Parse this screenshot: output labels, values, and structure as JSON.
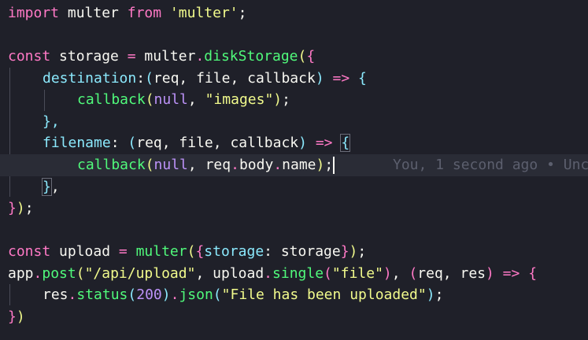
{
  "editor": {
    "blame_text": "You, 1 second ago • Unc",
    "colors": {
      "background": "#1f2029",
      "current_line": "#2a2c36",
      "keyword": "#ff79c6",
      "string": "#f1fa8c",
      "function": "#50fa7b",
      "property": "#8be9fd",
      "number": "#bd93f9",
      "text": "#f8f8f2"
    },
    "code": {
      "l1": {
        "import": "import",
        "multer": " multer ",
        "from": "from",
        "module": " 'multer'",
        "semi": ";"
      },
      "l3": {
        "const": "const",
        "name": " storage ",
        "eq": "= ",
        "obj": "multer",
        "dot": ".",
        "method": "diskStorage",
        "open": "(",
        "brace": "{"
      },
      "l4": {
        "key": "destination",
        "colon": ":",
        "open": "(",
        "params": "req, file, callback",
        "close": ")",
        "arrow": " => ",
        "brace": "{"
      },
      "l5": {
        "fn": "callback",
        "open": "(",
        "arg1": "null",
        "comma": ", ",
        "arg2": "\"images\"",
        "close": ")",
        "semi": ";"
      },
      "l6": {
        "close": "},"
      },
      "l7": {
        "key": "filename",
        "colon": ": ",
        "open": "(",
        "params": "req, file, callback",
        "close": ")",
        "arrow": " => ",
        "brace": "{"
      },
      "l8": {
        "fn": "callback",
        "open": "(",
        "arg1": "null",
        "comma": ", ",
        "obj": "req",
        "dot1": ".",
        "prop1": "body",
        "dot2": ".",
        "prop2": "name",
        "close": ")",
        "semi": ";"
      },
      "l9": {
        "close": "}",
        "comma": ","
      },
      "l10": {
        "close": "}",
        "paren": ")",
        "semi": ";"
      },
      "l12": {
        "const": "const",
        "name": " upload ",
        "eq": "= ",
        "fn": "multer",
        "open": "(",
        "brace": "{",
        "key": "storage",
        "colon": ": ",
        "val": "storage",
        "bclose": "}",
        "close": ")",
        "semi": ";"
      },
      "l13": {
        "obj": "app",
        "dot": ".",
        "method": "post",
        "open": "(",
        "route": "\"/api/upload\"",
        "comma": ", ",
        "obj2": "upload",
        "dot2": ".",
        "method2": "single",
        "open2": "(",
        "field": "\"file\"",
        "close2": ")",
        "comma2": ", ",
        "open3": "(",
        "params": "req, res",
        "close3": ")",
        "arrow": " => ",
        "brace": "{"
      },
      "l14": {
        "obj": "res",
        "dot": ".",
        "method": "status",
        "open": "(",
        "code": "200",
        "close": ")",
        "dot2": ".",
        "method2": "json",
        "open2": "(",
        "msg": "\"File has been uploaded\"",
        "close2": ")",
        "semi": ";"
      },
      "l15": {
        "brace": "}",
        "paren": ")"
      }
    }
  }
}
